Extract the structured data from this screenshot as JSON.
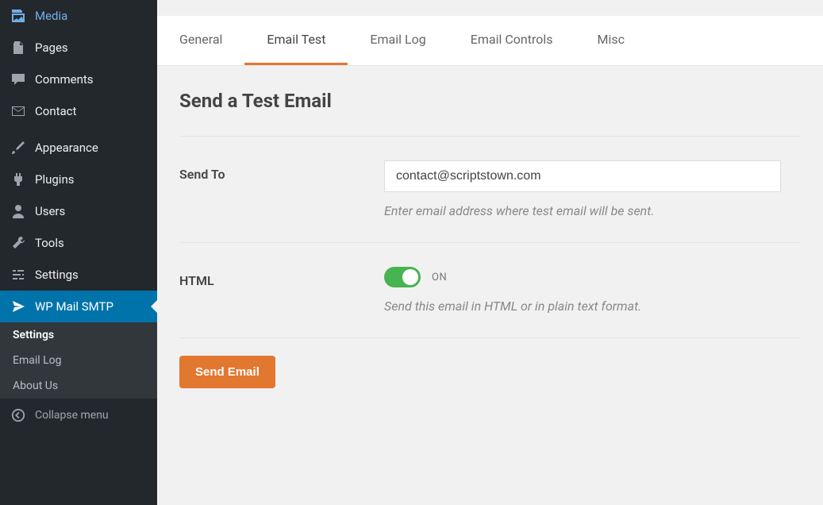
{
  "sidebar": {
    "items": [
      {
        "label": "Media"
      },
      {
        "label": "Pages"
      },
      {
        "label": "Comments"
      },
      {
        "label": "Contact"
      },
      {
        "label": "Appearance"
      },
      {
        "label": "Plugins"
      },
      {
        "label": "Users"
      },
      {
        "label": "Tools"
      },
      {
        "label": "Settings"
      },
      {
        "label": "WP Mail SMTP"
      }
    ],
    "submenu": [
      {
        "label": "Settings"
      },
      {
        "label": "Email Log"
      },
      {
        "label": "About Us"
      }
    ],
    "collapse": "Collapse menu"
  },
  "tabs": [
    {
      "label": "General"
    },
    {
      "label": "Email Test"
    },
    {
      "label": "Email Log"
    },
    {
      "label": "Email Controls"
    },
    {
      "label": "Misc"
    }
  ],
  "page": {
    "title": "Send a Test Email",
    "send_to_label": "Send To",
    "send_to_value": "contact@scriptstown.com",
    "send_to_help": "Enter email address where test email will be sent.",
    "html_label": "HTML",
    "html_toggle_state": "ON",
    "html_help": "Send this email in HTML or in plain text format.",
    "submit_label": "Send Email"
  }
}
